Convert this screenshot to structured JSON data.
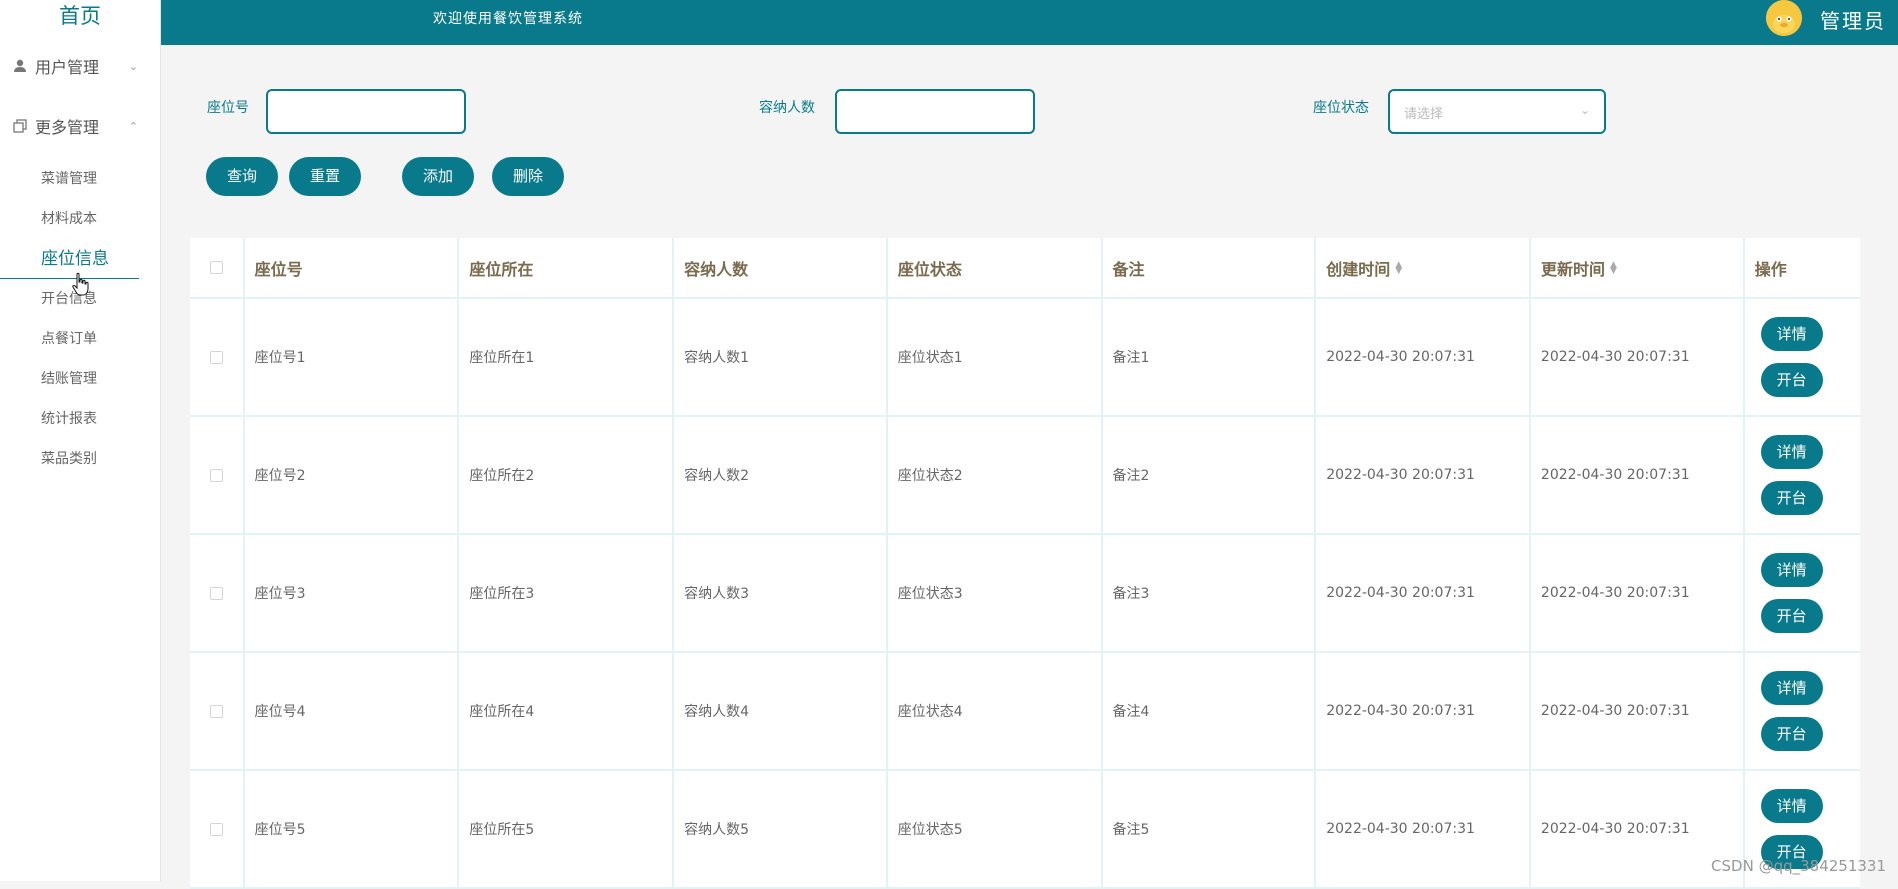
{
  "sidebar": {
    "home": "首页",
    "groups": [
      {
        "label": "用户管理",
        "icon": "user-icon",
        "chevron": "chevron-down-icon"
      },
      {
        "label": "更多管理",
        "icon": "copy-icon",
        "chevron": "chevron-up-icon"
      }
    ],
    "items": [
      {
        "label": "菜谱管理"
      },
      {
        "label": "材料成本"
      },
      {
        "label": "座位信息"
      },
      {
        "label": "开台信息"
      },
      {
        "label": "点餐订单"
      },
      {
        "label": "结账管理"
      },
      {
        "label": "统计报表"
      },
      {
        "label": "菜品类别"
      }
    ]
  },
  "header": {
    "welcome": "欢迎使用餐饮管理系统",
    "admin": "管理员"
  },
  "filters": {
    "seat_no_label": "座位号",
    "capacity_label": "容纳人数",
    "status_label": "座位状态",
    "status_placeholder": "请选择"
  },
  "buttons": {
    "query": "查询",
    "reset": "重置",
    "add": "添加",
    "delete": "删除"
  },
  "table": {
    "columns": [
      "座位号",
      "座位所在",
      "容纳人数",
      "座位状态",
      "备注",
      "创建时间",
      "更新时间",
      "操作"
    ],
    "rows": [
      {
        "seat": "座位号1",
        "location": "座位所在1",
        "capacity": "容纳人数1",
        "status": "座位状态1",
        "note": "备注1",
        "created": "2022-04-30 20:07:31",
        "updated": "2022-04-30 20:07:31"
      },
      {
        "seat": "座位号2",
        "location": "座位所在2",
        "capacity": "容纳人数2",
        "status": "座位状态2",
        "note": "备注2",
        "created": "2022-04-30 20:07:31",
        "updated": "2022-04-30 20:07:31"
      },
      {
        "seat": "座位号3",
        "location": "座位所在3",
        "capacity": "容纳人数3",
        "status": "座位状态3",
        "note": "备注3",
        "created": "2022-04-30 20:07:31",
        "updated": "2022-04-30 20:07:31"
      },
      {
        "seat": "座位号4",
        "location": "座位所在4",
        "capacity": "容纳人数4",
        "status": "座位状态4",
        "note": "备注4",
        "created": "2022-04-30 20:07:31",
        "updated": "2022-04-30 20:07:31"
      },
      {
        "seat": "座位号5",
        "location": "座位所在5",
        "capacity": "容纳人数5",
        "status": "座位状态5",
        "note": "备注5",
        "created": "2022-04-30 20:07:31",
        "updated": "2022-04-30 20:07:31"
      }
    ],
    "op_detail": "详情",
    "op_open": "开台"
  },
  "watermark": "CSDN @qq_384251331",
  "colors": {
    "accent": "#097a8c",
    "header_text": "#7a6a4e"
  }
}
